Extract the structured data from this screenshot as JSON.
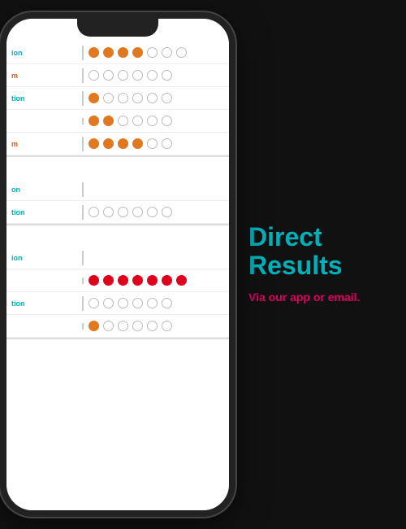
{
  "phone": {
    "sections": [
      {
        "id": "section1",
        "rows": [
          {
            "label": "ion",
            "labelColor": "blue",
            "dots": [
              "filled-orange",
              "filled-orange",
              "filled-orange",
              "filled-orange",
              "empty",
              "empty",
              "empty"
            ]
          },
          {
            "label": "m",
            "labelColor": "orange",
            "dots": [
              "empty",
              "empty",
              "empty",
              "empty",
              "empty",
              "empty",
              "empty"
            ]
          },
          {
            "label": "tion",
            "labelColor": "blue",
            "dots": [
              "filled-orange",
              "empty",
              "empty",
              "empty",
              "empty",
              "empty"
            ]
          },
          {
            "label": "",
            "labelColor": "orange",
            "dots": [
              "filled-orange",
              "filled-orange",
              "empty",
              "empty",
              "empty",
              "empty"
            ]
          },
          {
            "label": "m",
            "labelColor": "orange",
            "dots": [
              "filled-orange",
              "filled-orange",
              "filled-orange",
              "filled-orange",
              "empty",
              "empty"
            ]
          }
        ]
      },
      {
        "id": "section2",
        "rows": [
          {
            "label": "on",
            "labelColor": "blue",
            "dots": []
          },
          {
            "label": "tion",
            "labelColor": "blue",
            "dots": [
              "empty",
              "empty",
              "empty",
              "empty",
              "empty",
              "empty"
            ]
          }
        ]
      },
      {
        "id": "section3",
        "rows": [
          {
            "label": "ion",
            "labelColor": "blue",
            "dots": []
          },
          {
            "label": "",
            "labelColor": "red",
            "dots": [
              "filled-red",
              "filled-red",
              "filled-red",
              "filled-red",
              "filled-red",
              "filled-red",
              "filled-red"
            ]
          },
          {
            "label": "tion",
            "labelColor": "blue",
            "dots": [
              "empty",
              "empty",
              "empty",
              "empty",
              "empty",
              "empty"
            ]
          },
          {
            "label": "",
            "labelColor": "orange",
            "dots": [
              "filled-orange",
              "empty",
              "empty",
              "empty",
              "empty",
              "empty"
            ]
          }
        ]
      }
    ]
  },
  "right_panel": {
    "heading_line1": "Direct",
    "heading_line2": "Results",
    "subtext": "Via our app or email."
  }
}
